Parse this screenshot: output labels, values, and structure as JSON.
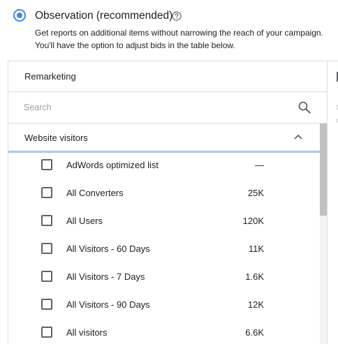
{
  "targeting_option": {
    "title": "Observation (recommended)",
    "selected": true,
    "help_icon": "help-circle-icon",
    "description_line1": "Get reports on additional items without narrowing the reach of your campaign.",
    "description_line2": "You'll have the option to adjust bids in the table below."
  },
  "panel": {
    "header": "Remarketing",
    "search": {
      "placeholder": "Search",
      "value": ""
    },
    "section": {
      "label": "Website visitors",
      "expanded": true
    },
    "items": [
      {
        "label": "AdWords optimized list",
        "size": "—",
        "checked": false
      },
      {
        "label": "All Converters",
        "size": "25K",
        "checked": false
      },
      {
        "label": "All Users",
        "size": "120K",
        "checked": false
      },
      {
        "label": "All Visitors - 60 Days",
        "size": "11K",
        "checked": false
      },
      {
        "label": "All Visitors - 7 Days",
        "size": "1.6K",
        "checked": false
      },
      {
        "label": "All Visitors - 90 Days",
        "size": "12K",
        "checked": false
      },
      {
        "label": "All visitors",
        "size": "6.6K",
        "checked": false
      }
    ]
  },
  "colors": {
    "accent": "#4a80f5",
    "section_underline": "#a8c7fa",
    "border": "#dadce0"
  }
}
